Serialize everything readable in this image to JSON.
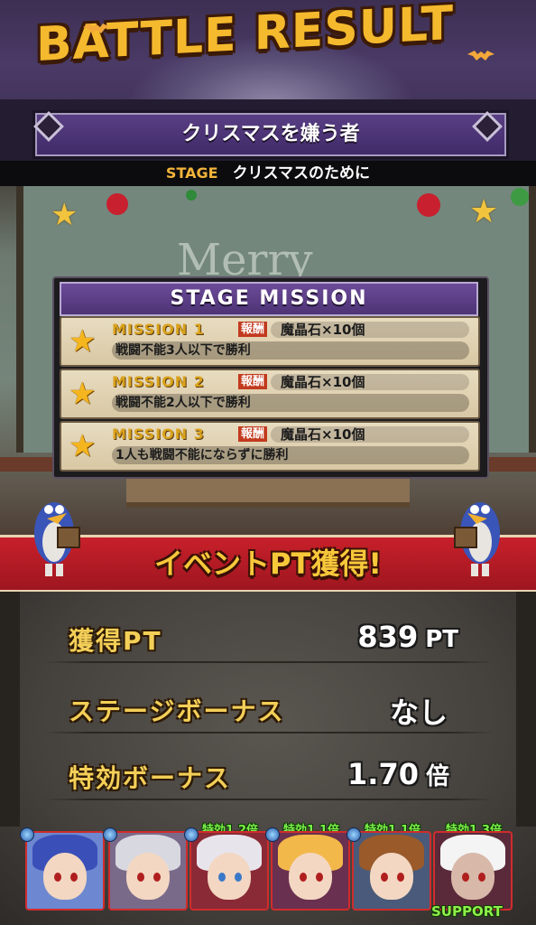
{
  "header": {
    "title": "BATTLE RESULT",
    "opponent": "クリスマスを嫌う者",
    "stage_label": "STAGE",
    "stage_name": "クリスマスのために"
  },
  "scene": {
    "board_text": "Merry"
  },
  "mission": {
    "heading": "STAGE MISSION",
    "reward_label": "報酬",
    "items": [
      {
        "name": "MISSION 1",
        "reward": "魔晶石×10個",
        "condition": "戦闘不能3人以下で勝利"
      },
      {
        "name": "MISSION 2",
        "reward": "魔晶石×10個",
        "condition": "戦闘不能2人以下で勝利"
      },
      {
        "name": "MISSION 3",
        "reward": "魔晶石×10個",
        "condition": "1人も戦闘不能にならずに勝利"
      }
    ]
  },
  "event": {
    "banner": "イベントPT獲得!"
  },
  "results": {
    "points": {
      "label": "獲得PT",
      "value": "839",
      "unit": "PT"
    },
    "stage_bonus": {
      "label": "ステージボーナス",
      "value": "なし"
    },
    "special_bonus": {
      "label": "特効ボーナス",
      "value": "1.70",
      "unit": "倍"
    }
  },
  "party": {
    "members": [
      {
        "bonus": ""
      },
      {
        "bonus": ""
      },
      {
        "bonus": "特効1.2倍"
      },
      {
        "bonus": "特効1.1倍"
      },
      {
        "bonus": "特効1.1倍"
      },
      {
        "bonus": "特効1.3倍"
      }
    ],
    "support_label": "SUPPORT"
  },
  "colors": {
    "accent_gold": "#f4cf58",
    "banner_red": "#c8202a",
    "mission_purple": "#5a3f86",
    "bonus_green": "#7cf04a"
  }
}
